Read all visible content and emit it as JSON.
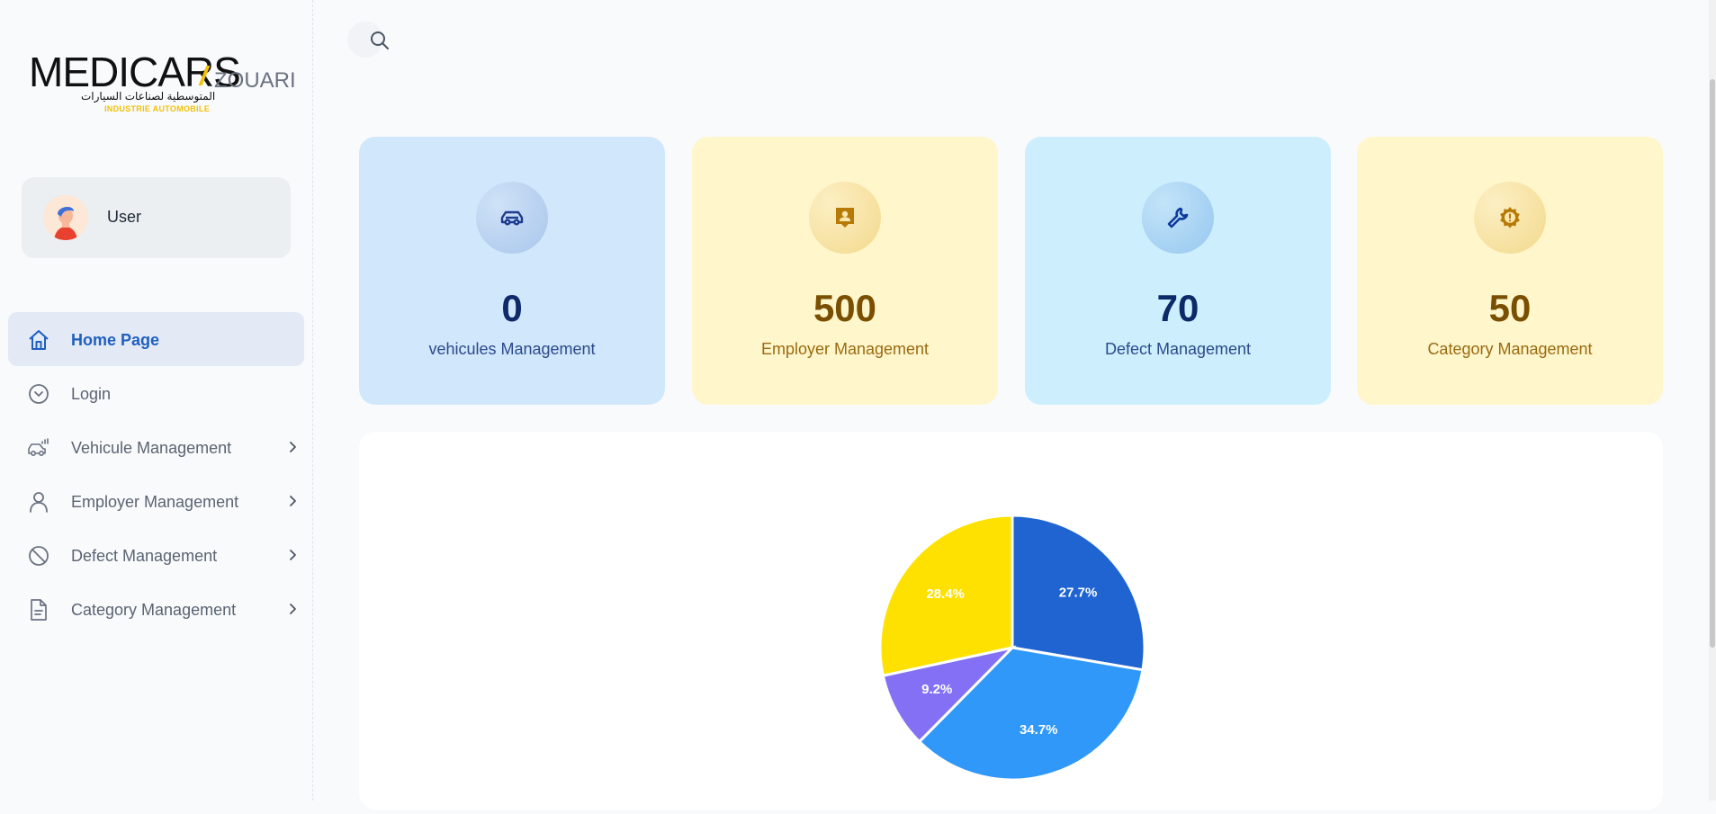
{
  "brand": {
    "name": "MEDICARS",
    "suffix": "ZOUARI",
    "arabic": "المتوسطية لصناعات السيارات",
    "tagline": "INDUSTRIE AUTOMOBILE"
  },
  "user": {
    "name": "User"
  },
  "sidebar": {
    "items": [
      {
        "label": "Home Page",
        "icon": "home-icon",
        "active": true
      },
      {
        "label": "Login",
        "icon": "chevron-circle-icon"
      },
      {
        "label": "Vehicule Management",
        "icon": "car-icon",
        "has_submenu": true
      },
      {
        "label": "Employer Management",
        "icon": "person-icon",
        "has_submenu": true
      },
      {
        "label": "Defect Management",
        "icon": "ban-icon",
        "has_submenu": true
      },
      {
        "label": "Category Management",
        "icon": "document-icon",
        "has_submenu": true
      }
    ]
  },
  "stats": [
    {
      "value": "0",
      "label": "vehicules Management",
      "icon": "car-icon",
      "bg": "#d1e7fb",
      "icon_bg": "#b9d3f2",
      "value_color": "#10296a",
      "label_color": "#2c4a8a"
    },
    {
      "value": "500",
      "label": "Employer Management",
      "icon": "id-badge-icon",
      "bg": "#fff6cc",
      "icon_bg": "#f8e4a6",
      "value_color": "#7a4f01",
      "label_color": "#9a6a10"
    },
    {
      "value": "70",
      "label": "Defect Management",
      "icon": "wrench-icon",
      "bg": "#cdeefc",
      "icon_bg": "#a9d8f5",
      "value_color": "#0c2a6a",
      "label_color": "#2c4a8a"
    },
    {
      "value": "50",
      "label": "Category Management",
      "icon": "gear-alert-icon",
      "bg": "#fff6cc",
      "icon_bg": "#f8e4a6",
      "value_color": "#7a4f01",
      "label_color": "#9a6a10"
    }
  ],
  "chart_data": {
    "type": "pie",
    "values": [
      27.7,
      34.7,
      9.2,
      28.4
    ],
    "labels": [
      "27.7%",
      "34.7%",
      "9.2%",
      "28.4%"
    ],
    "colors": [
      "#1f64d1",
      "#2f98f8",
      "#8470f5",
      "#ffe100"
    ]
  }
}
